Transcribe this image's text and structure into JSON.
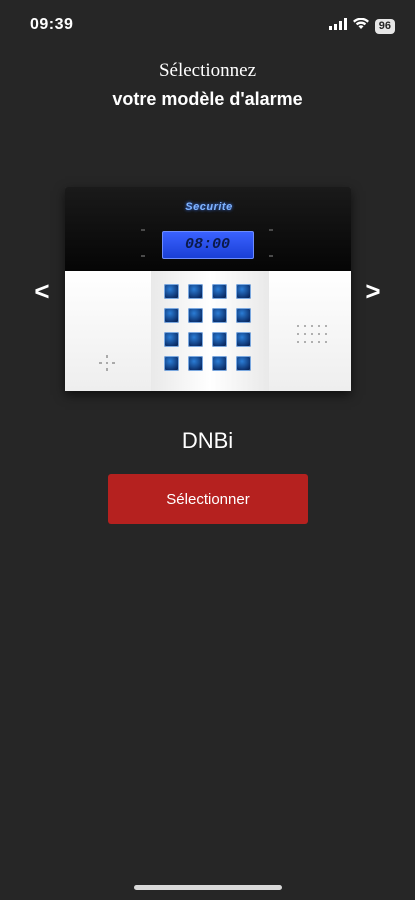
{
  "status_bar": {
    "time": "09:39",
    "battery": "96",
    "signal_icon": "cellular-signal-icon",
    "wifi_icon": "wifi-icon"
  },
  "header": {
    "title_line1": "Sélectionnez",
    "title_line2": "votre modèle d'alarme"
  },
  "carousel": {
    "prev_label": "<",
    "next_label": ">",
    "device": {
      "brand": "Securite",
      "lcd_time": "08:00"
    },
    "model_name": "DNBi"
  },
  "actions": {
    "select_label": "Sélectionner",
    "select_color": "#b5211f"
  },
  "colors": {
    "background": "#262626",
    "text": "#ffffff"
  }
}
